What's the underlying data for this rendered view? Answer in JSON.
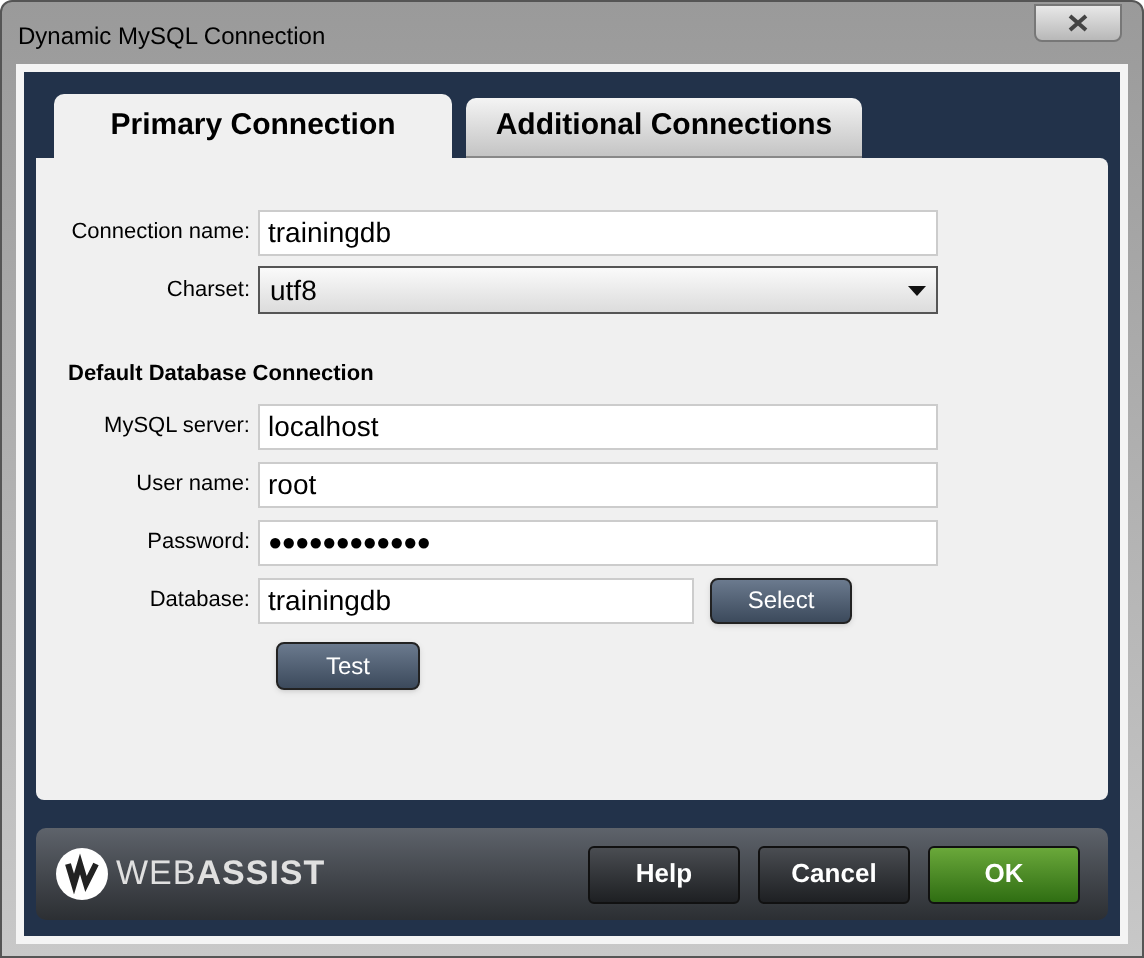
{
  "window": {
    "title": "Dynamic MySQL Connection"
  },
  "tabs": [
    {
      "label": "Primary Connection",
      "selected": true
    },
    {
      "label": "Additional Connections",
      "selected": false
    }
  ],
  "fields": [
    {
      "kind": "text",
      "label": "Connection name:",
      "value": "trainingdb"
    },
    {
      "kind": "select",
      "label": "Charset:",
      "value": "utf8"
    }
  ],
  "section": {
    "heading": "Default Database Connection",
    "fields": [
      {
        "kind": "text",
        "label": "MySQL server:",
        "value": "localhost"
      },
      {
        "kind": "text",
        "label": "User name:",
        "value": "root"
      },
      {
        "kind": "password",
        "label": "Password:",
        "value": "●●●●●●●●●●●●"
      },
      {
        "kind": "text-button",
        "label": "Database:",
        "value": "trainingdb",
        "button": "Select"
      }
    ],
    "test_button": "Test"
  },
  "footer": {
    "logo": {
      "light": "WEB",
      "bold": "ASSIST"
    },
    "buttons": [
      {
        "label": "Help",
        "kind": "normal"
      },
      {
        "label": "Cancel",
        "kind": "normal"
      },
      {
        "label": "OK",
        "kind": "primary"
      }
    ]
  }
}
